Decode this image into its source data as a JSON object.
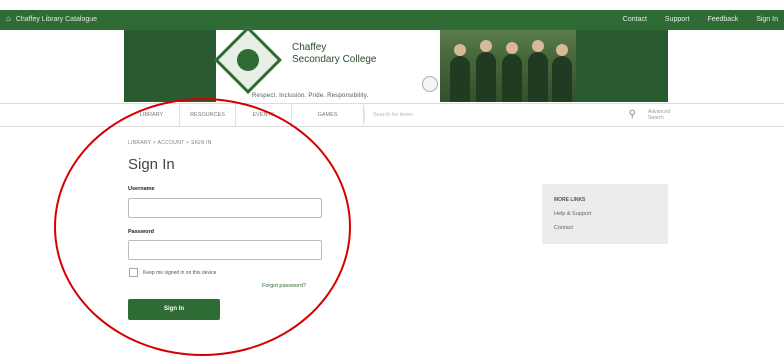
{
  "topbar": {
    "home_label": "Chaffey Library Catalogue",
    "links": [
      "Contact",
      "Support",
      "Feedback",
      "Sign In"
    ]
  },
  "banner": {
    "school_name_line1": "Chaffey",
    "school_name_line2": "Secondary College",
    "motto": "Respect. Inclusion. Pride. Responsibility."
  },
  "nav": {
    "tabs": [
      "LIBRARY",
      "RESOURCES",
      "EVENTS",
      "GAMES"
    ],
    "search_placeholder": "Search for items",
    "advanced_line1": "Advanced",
    "advanced_line2": "Search"
  },
  "breadcrumb": "LIBRARY  >  ACCOUNT  >  SIGN IN",
  "page_title": "Sign In",
  "form": {
    "username_label": "Username",
    "password_label": "Password",
    "remember_label": "Keep me signed in on this device",
    "forgot_label": "Forgot password?",
    "signin_label": "Sign In"
  },
  "more_links": {
    "heading": "MORE LINKS",
    "items": [
      "Help & Support",
      "Contact"
    ]
  },
  "colors": {
    "brand_green": "#2f6b34",
    "annotation_red": "#d40000"
  }
}
